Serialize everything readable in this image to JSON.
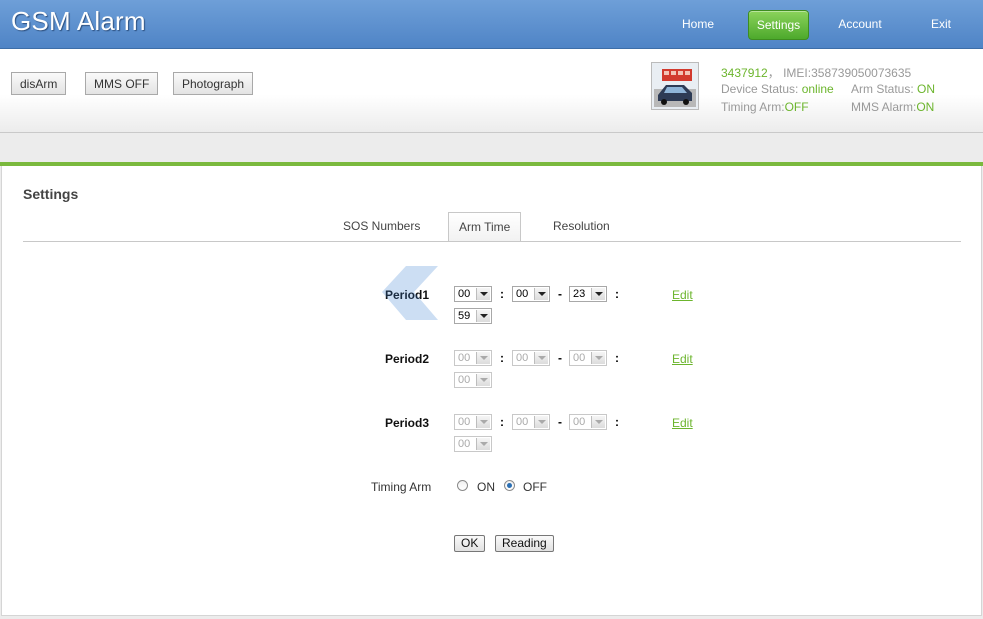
{
  "app": {
    "title": "GSM Alarm"
  },
  "nav": {
    "home": "Home",
    "settings": "Settings",
    "account": "Account",
    "exit": "Exit"
  },
  "toolbar": {
    "disarm_label": "disArm",
    "mms_label": "MMS OFF",
    "photograph_label": "Photograph"
  },
  "device": {
    "id": "3437912",
    "id_sep": "，",
    "imei_label": "IMEI:",
    "imei": "358739050073635",
    "device_status_label": "Device Status: ",
    "device_status": "online",
    "arm_status_label": "Arm Status: ",
    "arm_status": "ON",
    "timing_arm_label": "Timing Arm:",
    "timing_arm": "OFF",
    "mms_alarm_label": "MMS Alarm:",
    "mms_alarm": "ON"
  },
  "settings": {
    "title": "Settings",
    "tabs": [
      "SOS Numbers",
      "Arm Time",
      "Resolution"
    ],
    "active_tab": "Arm Time",
    "periods": [
      {
        "label": "Period1",
        "start_h": "00",
        "start_m": "00",
        "end_h": "23",
        "end_m": "59",
        "enabled": true,
        "edit": "Edit"
      },
      {
        "label": "Period2",
        "start_h": "00",
        "start_m": "00",
        "end_h": "00",
        "end_m": "00",
        "enabled": false,
        "edit": "Edit"
      },
      {
        "label": "Period3",
        "start_h": "00",
        "start_m": "00",
        "end_h": "00",
        "end_m": "00",
        "enabled": false,
        "edit": "Edit"
      }
    ],
    "time_sep": ":",
    "range_sep": "-",
    "timing_arm_label": "Timing Arm",
    "timing_arm_on": "ON",
    "timing_arm_off": "OFF",
    "timing_arm_selected": "OFF",
    "ok_label": "OK",
    "reading_label": "Reading"
  },
  "colors": {
    "header": "#4f84c6",
    "accent_green": "#6cb52d",
    "bar_green": "#7ab93d"
  }
}
